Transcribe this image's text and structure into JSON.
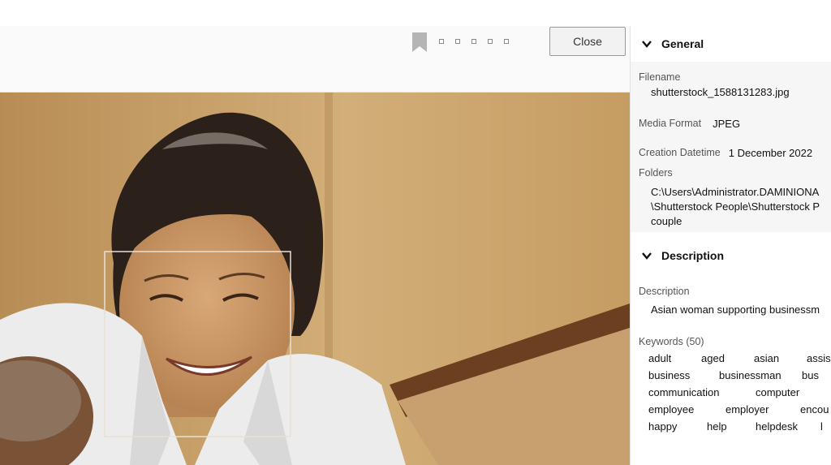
{
  "viewer": {
    "close_label": "Close",
    "page_dot_count": 5
  },
  "panel": {
    "general": {
      "title": "General",
      "filename_label": "Filename",
      "filename_value": "shutterstock_1588131283.jpg",
      "media_format_label": "Media Format",
      "media_format_value": "JPEG",
      "creation_label": "Creation Datetime",
      "creation_value": "1 December 2022",
      "folders_label": "Folders",
      "folders_lines": [
        "C:\\Users\\Administrator.DAMINIONA",
        "\\Shutterstock People\\Shutterstock P",
        "couple"
      ]
    },
    "description": {
      "title": "Description",
      "description_label": "Description",
      "description_value": "Asian woman supporting businessm",
      "keywords_label": "Keywords (50)",
      "keyword_rows": [
        [
          "adult",
          "aged",
          "asian",
          "assis"
        ],
        [
          "business",
          "businessman",
          "bus"
        ],
        [
          "communication",
          "computer",
          ""
        ],
        [
          "employee",
          "employer",
          "encou"
        ],
        [
          "happy",
          "help",
          "helpdesk",
          "l"
        ]
      ]
    }
  },
  "colors": {
    "wall": "#c9a26a",
    "hair": "#2b211a",
    "shirt": "#ececec",
    "face_box": "#e8e0d4"
  }
}
